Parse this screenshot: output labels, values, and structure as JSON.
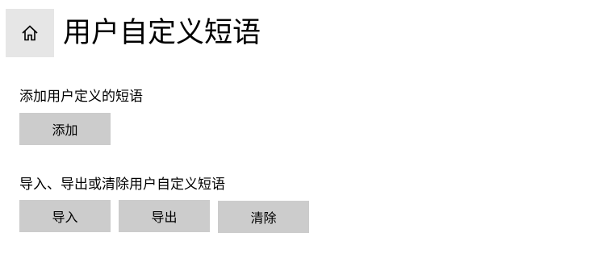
{
  "header": {
    "home_icon": "home-icon",
    "title": "用户自定义短语"
  },
  "add_section": {
    "label": "添加用户定义的短语",
    "add_button": "添加"
  },
  "manage_section": {
    "label": "导入、导出或清除用户自定义短语",
    "import_button": "导入",
    "export_button": "导出",
    "clear_button": "清除"
  },
  "colors": {
    "button_bg": "#cccccc",
    "home_bg": "#e6e6e6",
    "text": "#000000"
  }
}
